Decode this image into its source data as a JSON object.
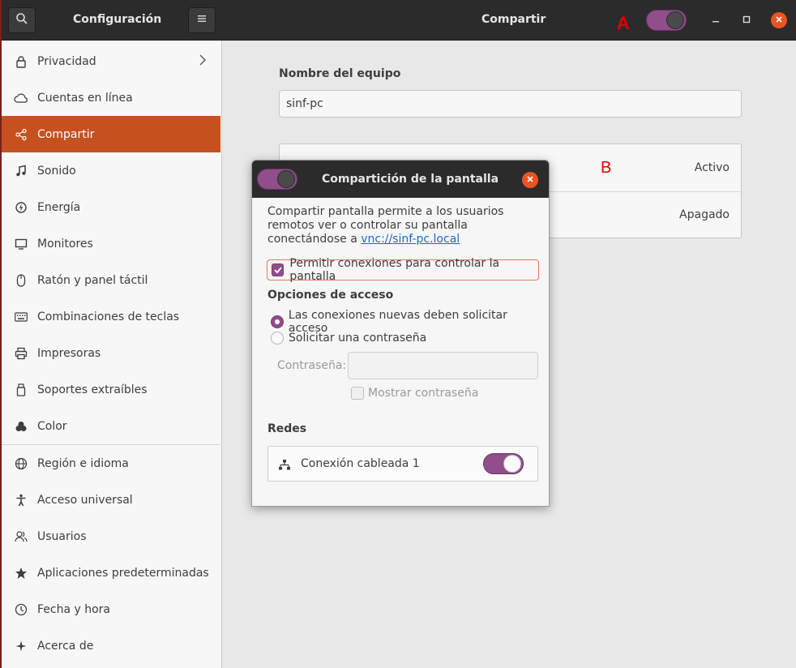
{
  "headerbar": {
    "search_icon": "search-icon",
    "app_title": "Configuración",
    "menu_icon": "hamburger-menu-icon",
    "page_title": "Compartir",
    "annotation_a": "A",
    "sharing_master_toggle": "on"
  },
  "sidebar": {
    "items": [
      {
        "label": "Privacidad",
        "icon": "lock-icon"
      },
      {
        "label": "Cuentas en línea",
        "icon": "cloud-icon"
      },
      {
        "label": "Compartir",
        "icon": "share-icon"
      },
      {
        "label": "Sonido",
        "icon": "music-note-icon"
      },
      {
        "label": "Energía",
        "icon": "power-icon"
      },
      {
        "label": "Monitores",
        "icon": "monitor-icon"
      },
      {
        "label": "Ratón y panel táctil",
        "icon": "mouse-icon"
      },
      {
        "label": "Combinaciones de teclas",
        "icon": "keyboard-icon"
      },
      {
        "label": "Impresoras",
        "icon": "printer-icon"
      },
      {
        "label": "Soportes extraíbles",
        "icon": "usb-drive-icon"
      },
      {
        "label": "Color",
        "icon": "color-palette-icon"
      },
      {
        "label": "Región e idioma",
        "icon": "globe-icon"
      },
      {
        "label": "Acceso universal",
        "icon": "accessibility-icon"
      },
      {
        "label": "Usuarios",
        "icon": "users-icon"
      },
      {
        "label": "Aplicaciones predeterminadas",
        "icon": "star-icon"
      },
      {
        "label": "Fecha y hora",
        "icon": "clock-icon"
      },
      {
        "label": "Acerca de",
        "icon": "plus-icon"
      }
    ],
    "active": "Compartir"
  },
  "main": {
    "computer_name_label": "Nombre del equipo",
    "computer_name_value": "sinf-pc",
    "annotation_b": "B",
    "services": [
      {
        "status": "Activo"
      },
      {
        "status": "Apagado"
      }
    ]
  },
  "dialog": {
    "title": "Compartición de la pantalla",
    "toggle": "on",
    "description_prefix": "Compartir pantalla permite a los usuarios remotos ver o controlar su pantalla conectándose a ",
    "description_link": "vnc://sinf-pc.local",
    "allow_control_label": "Permitir conexiones para controlar la pantalla",
    "allow_control_checked": true,
    "access_options_title": "Opciones de acceso",
    "radio_request_label": "Las conexiones nuevas deben solicitar acceso",
    "radio_password_label": "Solicitar una contraseña",
    "password_label": "Contraseña:",
    "password_value": "",
    "show_password_label": "Mostrar contraseña",
    "networks_title": "Redes",
    "network_name": "Conexión cableada 1",
    "network_enabled": true
  },
  "colors": {
    "accent": "#e95420",
    "sidebar_active": "#c7501f",
    "toggle_purple": "#924d8b",
    "annotation_red": "#e00000"
  }
}
